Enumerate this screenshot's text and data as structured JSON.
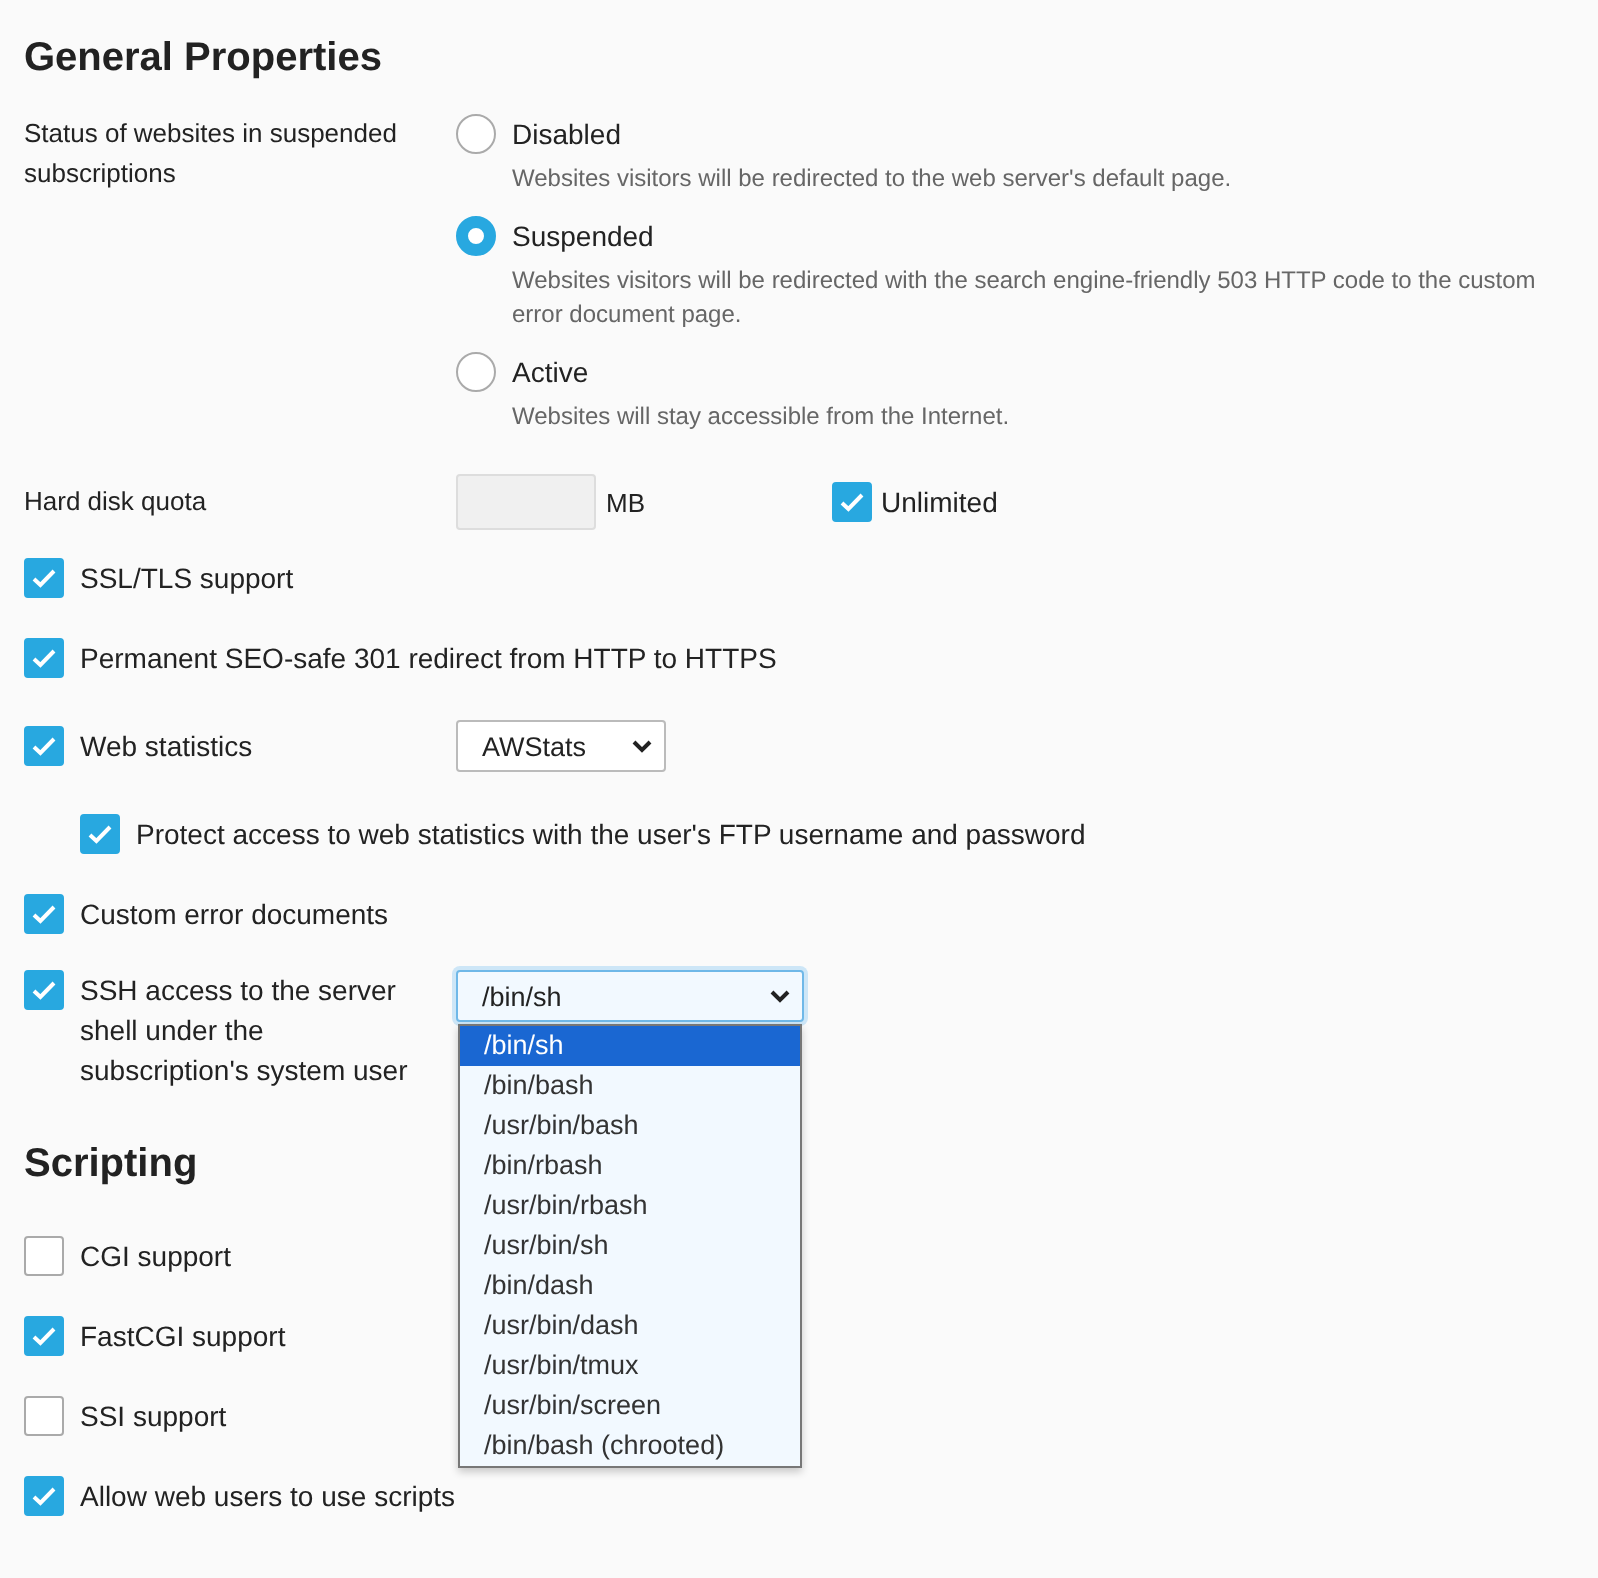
{
  "title": "General Properties",
  "site_status": {
    "label": "Status of websites in suspended subscriptions",
    "options": [
      {
        "label": "Disabled",
        "description": "Websites visitors will be redirected to the web server's default page.",
        "selected": false
      },
      {
        "label": "Suspended",
        "description": "Websites visitors will be redirected with the search engine-friendly 503 HTTP code to the custom error document page.",
        "selected": true
      },
      {
        "label": "Active",
        "description": "Websites will stay accessible from the Internet.",
        "selected": false
      }
    ]
  },
  "quota": {
    "label": "Hard disk quota",
    "unit": "MB",
    "unlimited": {
      "label": "Unlimited",
      "checked": true
    }
  },
  "options": [
    {
      "kind": "checkbox",
      "label": "SSL/TLS support",
      "checked": true
    },
    {
      "kind": "checkbox",
      "label": "Permanent SEO-safe 301 redirect from HTTP to HTTPS",
      "checked": true
    },
    {
      "kind": "select",
      "label": "Web statistics",
      "checked": true,
      "value": "AWStats",
      "children": [
        {
          "label": "Protect access to web statistics with the user's FTP username and password",
          "checked": true
        }
      ]
    },
    {
      "kind": "checkbox",
      "label": "Custom error documents",
      "checked": true
    },
    {
      "kind": "open_select",
      "label": "SSH access to the server shell under the subscription's system user",
      "checked": true,
      "value": "/bin/sh",
      "list": [
        {
          "label": "/bin/sh",
          "selected": true
        },
        {
          "label": "/bin/bash",
          "selected": false
        },
        {
          "label": "/usr/bin/bash",
          "selected": false
        },
        {
          "label": "/bin/rbash",
          "selected": false
        },
        {
          "label": "/usr/bin/rbash",
          "selected": false
        },
        {
          "label": "/usr/bin/sh",
          "selected": false
        },
        {
          "label": "/bin/dash",
          "selected": false
        },
        {
          "label": "/usr/bin/dash",
          "selected": false
        },
        {
          "label": "/usr/bin/tmux",
          "selected": false
        },
        {
          "label": "/usr/bin/screen",
          "selected": false
        },
        {
          "label": "/bin/bash (chrooted)",
          "selected": false
        }
      ]
    }
  ],
  "scripting": {
    "title": "Scripting",
    "options": [
      {
        "label": "CGI support",
        "checked": false
      },
      {
        "label": "FastCGI support",
        "checked": true
      },
      {
        "label": "SSI support",
        "checked": false
      },
      {
        "label": "Allow web users to use scripts",
        "checked": true
      }
    ]
  }
}
